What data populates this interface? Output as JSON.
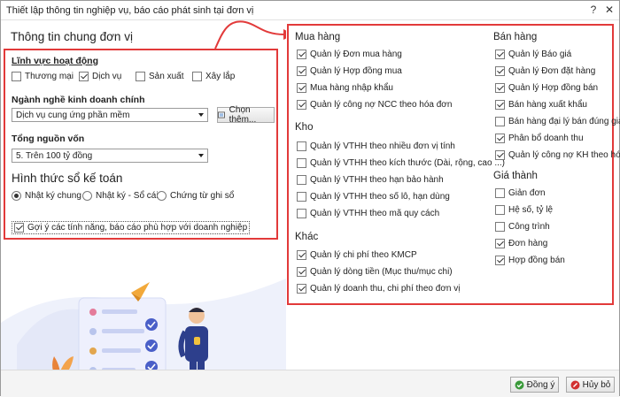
{
  "window": {
    "title": "Thiết lập thông tin nghiệp vụ, báo cáo phát sinh tại đơn vị",
    "help_label": "?",
    "close_label": "✕"
  },
  "left": {
    "section_title": "Thông tin chung đơn vị",
    "field_label": "Lĩnh vực hoạt động",
    "fields": [
      {
        "label": "Thương mại",
        "checked": false
      },
      {
        "label": "Dịch vụ",
        "checked": true
      },
      {
        "label": "Sản xuất",
        "checked": false
      },
      {
        "label": "Xây lắp",
        "checked": false
      }
    ],
    "industry_label": "Ngành nghề kinh doanh chính",
    "industry_value": "Dịch vụ cung ứng phần mềm",
    "choose_more_label": "Chọn thêm...",
    "capital_label": "Tổng nguồn vốn",
    "capital_value": "5. Trên 100 tỷ đồng",
    "book_title": "Hình thức sổ kế toán",
    "book_options": [
      {
        "label": "Nhật ký chung",
        "selected": true
      },
      {
        "label": "Nhật ký - Sổ cái",
        "selected": false
      },
      {
        "label": "Chứng từ ghi sổ",
        "selected": false
      }
    ],
    "suggest_label": "Gợi ý các tính năng, báo cáo phù hợp với doanh nghiệp",
    "suggest_checked": true
  },
  "right": {
    "groups": [
      {
        "title": "Mua hàng",
        "items": [
          {
            "label": "Quản lý Đơn mua hàng",
            "checked": true
          },
          {
            "label": "Quản lý Hợp đồng mua",
            "checked": true
          },
          {
            "label": "Mua hàng nhập khẩu",
            "checked": true
          },
          {
            "label": "Quản lý công nợ NCC theo hóa đơn",
            "checked": true
          }
        ]
      },
      {
        "title": "Kho",
        "items": [
          {
            "label": "Quản lý VTHH theo nhiều đơn vị tính",
            "checked": false
          },
          {
            "label": "Quản lý VTHH theo kích thước (Dài, rộng, cao ...)",
            "checked": false
          },
          {
            "label": "Quản lý VTHH theo hạn bảo hành",
            "checked": false
          },
          {
            "label": "Quản lý VTHH theo số lô, hạn dùng",
            "checked": false
          },
          {
            "label": "Quản lý VTHH theo mã quy cách",
            "checked": false
          }
        ]
      },
      {
        "title": "Khác",
        "items": [
          {
            "label": "Quản lý chi phí theo KMCP",
            "checked": true
          },
          {
            "label": "Quản lý dòng tiền (Mục thu/mục chi)",
            "checked": true
          },
          {
            "label": "Quản lý doanh thu, chi phí theo đơn vị",
            "checked": true
          }
        ]
      },
      {
        "title": "Bán hàng",
        "items": [
          {
            "label": "Quản lý Báo giá",
            "checked": true
          },
          {
            "label": "Quản lý Đơn đặt hàng",
            "checked": true
          },
          {
            "label": "Quản lý Hợp đồng bán",
            "checked": true
          },
          {
            "label": "Bán hàng xuất khẩu",
            "checked": true
          },
          {
            "label": "Bán hàng đại lý bán đúng giá",
            "checked": false
          },
          {
            "label": "Phân bổ doanh thu",
            "checked": true
          },
          {
            "label": "Quản lý công nợ KH theo hóa đơn",
            "checked": true
          }
        ]
      },
      {
        "title": "Giá thành",
        "items": [
          {
            "label": "Giản đơn",
            "checked": false
          },
          {
            "label": "Hệ số, tỷ lệ",
            "checked": false
          },
          {
            "label": "Công trình",
            "checked": false
          },
          {
            "label": "Đơn hàng",
            "checked": true
          },
          {
            "label": "Hợp đồng bán",
            "checked": true
          }
        ]
      }
    ]
  },
  "footer": {
    "agree_label": "Đồng ý",
    "cancel_label": "Hủy bỏ"
  },
  "colors": {
    "highlight": "#e23a3a",
    "agree_icon": "#3a9a3a",
    "cancel_icon": "#d23030"
  }
}
